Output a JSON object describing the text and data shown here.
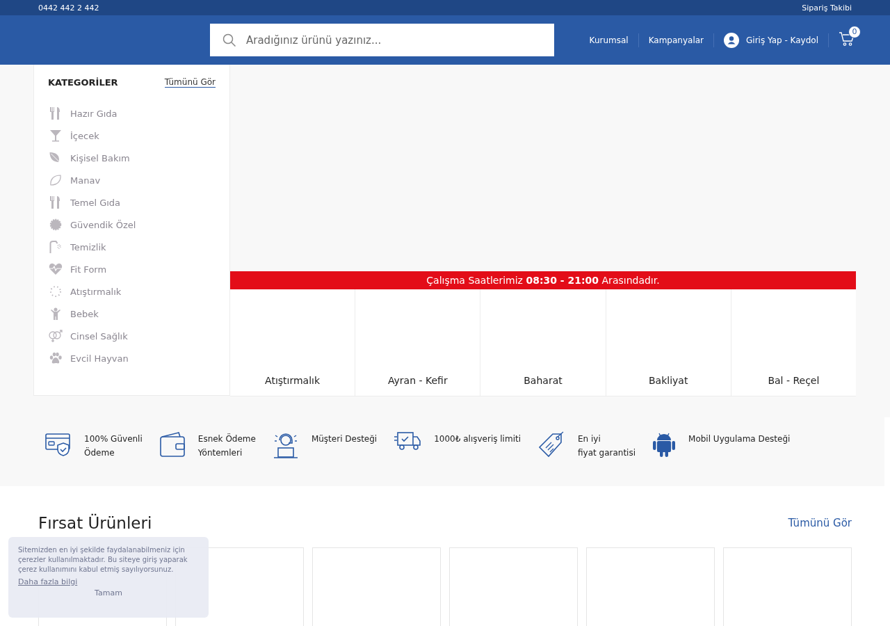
{
  "top_bar": {
    "phone": "0442 442 2 442",
    "order_tracking": "Sipariş Takibi"
  },
  "header": {
    "search": {
      "placeholder": "Aradığınız ürünü yazınız..."
    },
    "links": [
      "Kurumsal",
      "Kampanyalar"
    ],
    "account": "Giriş Yap - Kaydol",
    "cart_count": "0"
  },
  "sidebar": {
    "title": "KATEGORİLER",
    "see_all": "Tümünü Gör",
    "items": [
      {
        "label": "Hazır Gıda",
        "kind": "cutlery"
      },
      {
        "label": "İçecek",
        "kind": "glass"
      },
      {
        "label": "Kişisel Bakım",
        "kind": "leaf"
      },
      {
        "label": "Manav",
        "kind": "fruit"
      },
      {
        "label": "Temel Gıda",
        "kind": "cutlery"
      },
      {
        "label": "Güvendik Özel",
        "kind": "seal"
      },
      {
        "label": "Temizlik",
        "kind": "shower"
      },
      {
        "label": "Fit Form",
        "kind": "heart"
      },
      {
        "label": "Atıştırmalık",
        "kind": "dots"
      },
      {
        "label": "Bebek",
        "kind": "baby"
      },
      {
        "label": "Cinsel Sağlık",
        "kind": "gender"
      },
      {
        "label": "Evcil Hayvan",
        "kind": "paw"
      }
    ]
  },
  "notice": "Çalışma Saatlerimiz **08:30 - 21:00** Arasındadır.",
  "category_tiles": [
    "Atıştırmalık",
    "Ayran - Kefir",
    "Baharat",
    "Bakliyat",
    "Bal - Reçel"
  ],
  "features": [
    {
      "kind": "card",
      "lines": [
        "100% Güvenli",
        "Ödeme"
      ]
    },
    {
      "kind": "wallet",
      "lines": [
        "Esnek Ödeme",
        "Yöntemleri"
      ]
    },
    {
      "kind": "support",
      "lines": [
        "Müşteri Desteği"
      ]
    },
    {
      "kind": "truck",
      "lines": [
        "1000₺ alışveriş limiti"
      ]
    },
    {
      "kind": "tag",
      "lines": [
        "En iyi",
        "fiyat garantisi"
      ]
    },
    {
      "kind": "android",
      "lines": [
        "Mobil Uygulama Desteği"
      ]
    }
  ],
  "deals": {
    "title": "Fırsat Ürünleri",
    "see_all": "Tümünü Gör"
  },
  "cookie_notice": {
    "text": "Sitemizden en iyi şekilde faydalanabilmeniz için çerezler kullanılmaktadır. Bu siteye giriş yaparak çerez kullanımını kabul etmiş sayılıyorsunuz.",
    "link": "Daha fazla bilgi",
    "button": "Tamam"
  }
}
